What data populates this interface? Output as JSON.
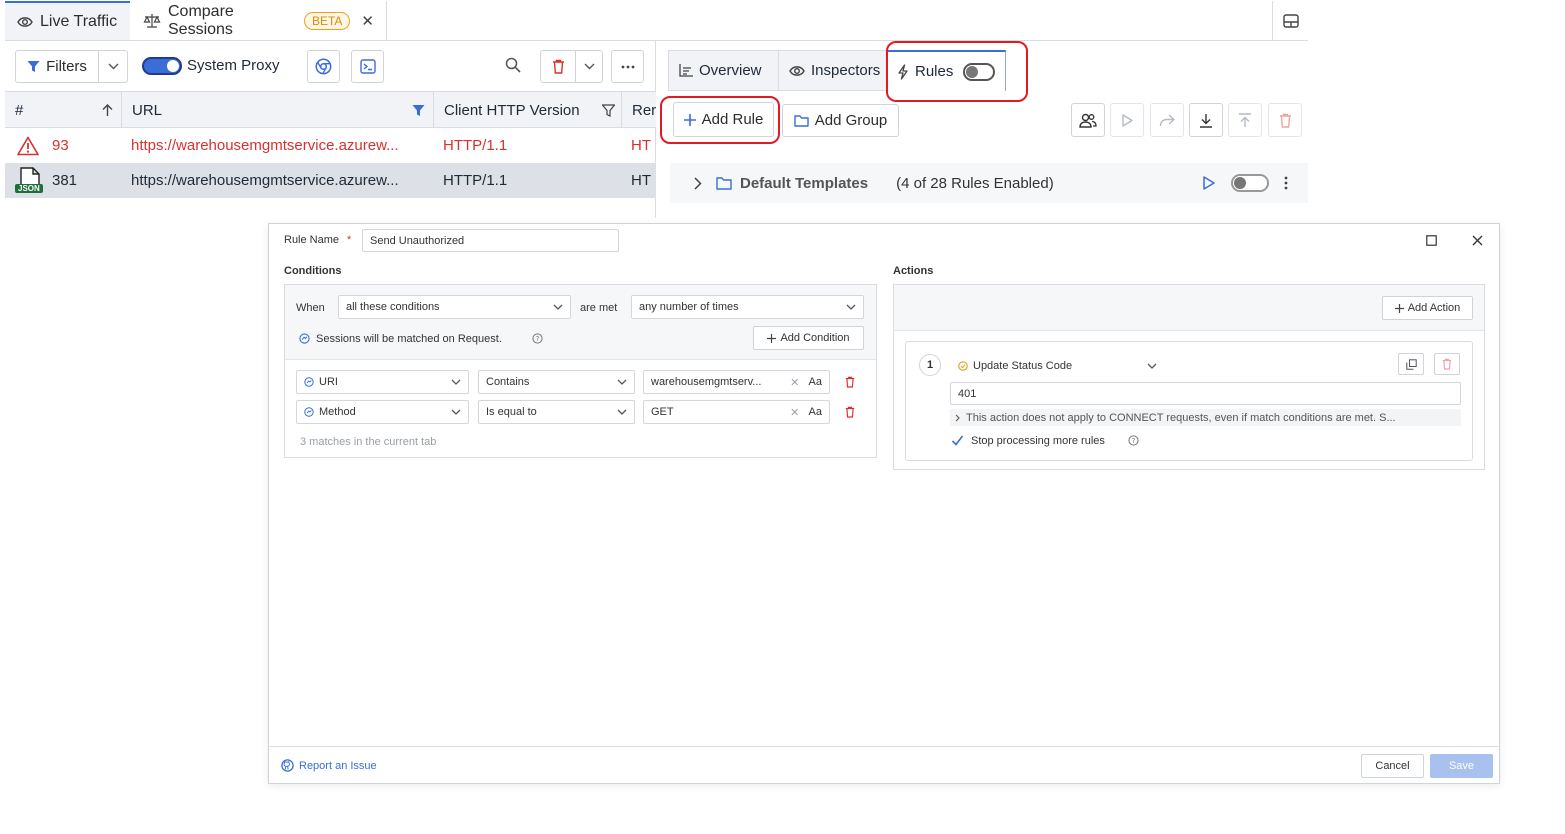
{
  "tabs": {
    "live_traffic": "Live Traffic",
    "compare_sessions": "Compare Sessions",
    "beta": "BETA"
  },
  "toolbar": {
    "filters": "Filters",
    "system_proxy": "System Proxy"
  },
  "grid": {
    "columns": [
      "#",
      "URL",
      "Client HTTP Version",
      "Rer"
    ],
    "rows": [
      {
        "id": "93",
        "url": "https://warehousemgmtservice.azurew...",
        "version": "HTTP/1.1",
        "rest": "HT",
        "status": "error"
      },
      {
        "id": "381",
        "url": "https://warehousemgmtservice.azurew...",
        "version": "HTTP/1.1",
        "rest": "HT",
        "status": "json"
      }
    ],
    "json_badge": "JSON"
  },
  "right_tabs": {
    "overview": "Overview",
    "inspectors": "Inspectors",
    "rules": "Rules"
  },
  "rules_panel": {
    "add_rule": "Add Rule",
    "add_group": "Add Group",
    "template_name": "Default Templates",
    "template_count": "(4 of 28 Rules Enabled)"
  },
  "dialog": {
    "rule_name_label": "Rule Name",
    "required_mark": "*",
    "rule_name_value": "Send Unauthorized",
    "conditions_title": "Conditions",
    "actions_title": "Actions",
    "when_label": "When",
    "when_value": "all these conditions",
    "are_met_label": "are met",
    "times_value": "any number of times",
    "match_note": "Sessions will be matched on Request.",
    "add_condition": "Add Condition",
    "conditions": [
      {
        "field": "URI",
        "operator": "Contains",
        "value": "warehousemgmtserv...",
        "case": "Aa"
      },
      {
        "field": "Method",
        "operator": "Is equal to",
        "value": "GET",
        "case": "Aa"
      }
    ],
    "match_count": "3 matches in the current tab",
    "add_action": "Add Action",
    "action_number": "1",
    "action_type": "Update Status Code",
    "status_value": "401",
    "action_note": "This action does not apply to CONNECT requests, even if match conditions are met. S...",
    "stop_processing": "Stop processing more rules",
    "report_issue": "Report an Issue",
    "cancel": "Cancel",
    "save": "Save"
  },
  "colors": {
    "accent": "#3b6dd8",
    "highlight_ring": "#e01b24",
    "error_text": "#d9302f",
    "save_disabled": "#a9c1ef"
  }
}
